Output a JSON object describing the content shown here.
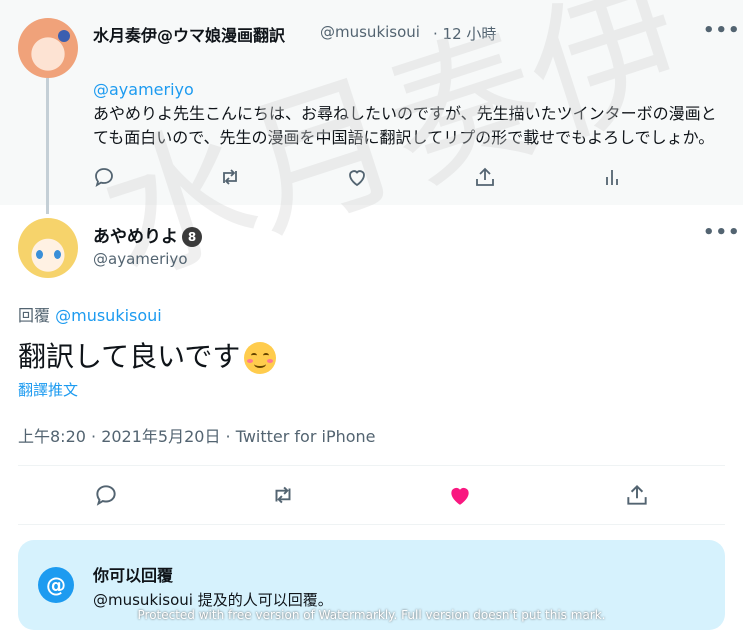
{
  "reply_tweet": {
    "author_name": "水月奏伊@ウマ娘漫画翻訳",
    "author_handle": "@musukisoui",
    "time": "· 12 小時",
    "mention": "@ayameriyo",
    "body": "あやめりよ先生こんにちは、お尋ねしたいのですが、先生描いたツインターボの漫画とても面白いので、先生の漫画を中国語に翻訳してリプの形で載せでもよろしでしょか。",
    "more_icon": "more-horizontal-icon",
    "actions": [
      "reply-icon",
      "retweet-icon",
      "like-icon",
      "share-icon",
      "analytics-icon"
    ]
  },
  "main_tweet": {
    "author_name": "あやめりよ",
    "badge": "8",
    "author_handle": "@ayameriyo",
    "replying_prefix": "回覆",
    "replying_to": "@musukisoui",
    "text": "翻訳して良いです",
    "translate_link": "翻譯推文",
    "meta": "上午8:20 · 2021年5月20日 · Twitter for iPhone",
    "actions": [
      "reply-icon",
      "retweet-icon",
      "like-filled-icon",
      "share-icon"
    ],
    "like_color": "#f91880"
  },
  "reply_restriction": {
    "title": "你可以回覆",
    "description_handle": "@musukisoui",
    "description_rest": " 提及的人可以回覆。"
  },
  "watermark": {
    "big_text": "水月奏伊",
    "footer": "Protected with free version of Watermarkly. Full version doesn't put this mark."
  },
  "colors": {
    "accent": "#1d9bf0",
    "muted": "#536471",
    "reply_box_bg": "#d6f2fd"
  }
}
